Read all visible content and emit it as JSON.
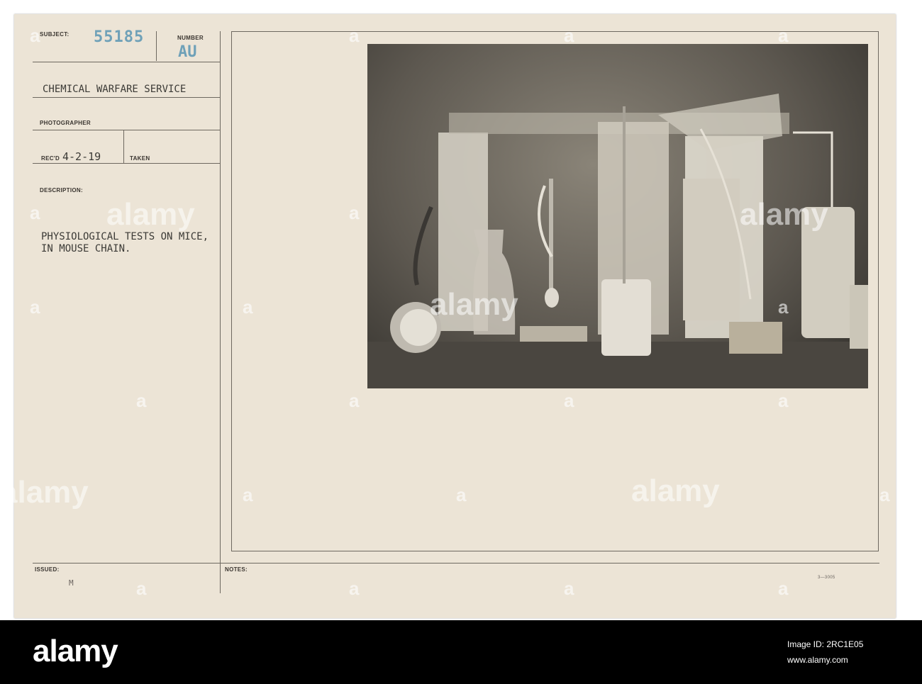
{
  "card": {
    "subject_label": "SUBJECT:",
    "subject_number": "55185",
    "number_label": "NUMBER",
    "number_value": "AU",
    "service": "CHEMICAL WARFARE SERVICE",
    "photographer_label": "PHOTOGRAPHER",
    "recd_label": "REC'D",
    "recd_date": "4-2-19",
    "taken_label": "TAKEN",
    "description_label": "DESCRIPTION:",
    "description_line1": "PHYSIOLOGICAL TESTS ON MICE,",
    "description_line2": "IN MOUSE CHAIN.",
    "issued_label": "ISSUED:",
    "issued_mark": "M",
    "notes_label": "NOTES:",
    "form_code": "3—3005"
  },
  "watermark": {
    "text": "alamy",
    "marker": "a"
  },
  "footer": {
    "logo": "alamy",
    "image_id_label": "Image ID: 2RC1E05",
    "site": "www.alamy.com"
  },
  "colors": {
    "card_bg": "#ece4d6",
    "stamp_blue": "#6fa1b8",
    "footer_bg": "#000000"
  }
}
